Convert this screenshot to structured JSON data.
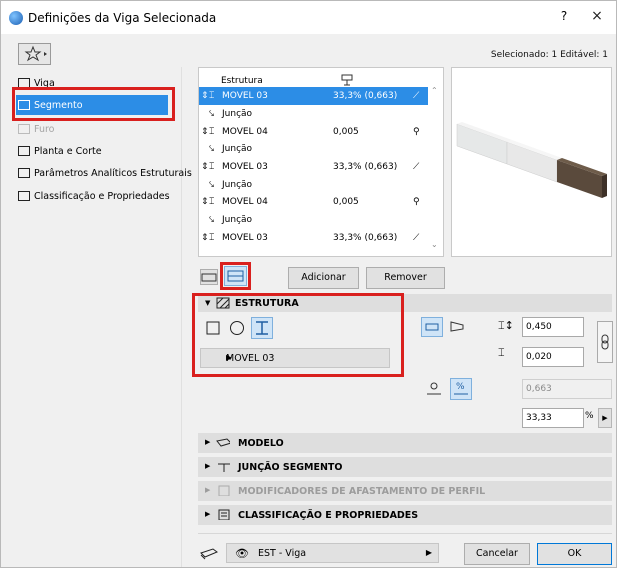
{
  "window": {
    "title": "Definições da Viga Selecionada",
    "help": "?",
    "close": "×"
  },
  "header": {
    "selected_info": "Selecionado: 1 Editável: 1"
  },
  "nav": {
    "items": [
      {
        "label": "Viga"
      },
      {
        "label": "Segmento"
      },
      {
        "label": "Furo"
      },
      {
        "label": "Planta e Corte"
      },
      {
        "label": "Parâmetros Analíticos Estruturais"
      },
      {
        "label": "Classificação e Propriedades"
      }
    ]
  },
  "segment_list": {
    "column_header": "Estrutura",
    "rows": [
      {
        "profile": "MOVEL 03",
        "value": "33,3% (0,663)"
      },
      {
        "junction": "Junção"
      },
      {
        "profile": "MOVEL 04",
        "value": "0,005"
      },
      {
        "junction": "Junção"
      },
      {
        "profile": "MOVEL 03",
        "value": "33,3% (0,663)"
      },
      {
        "junction": "Junção"
      },
      {
        "profile": "MOVEL 04",
        "value": "0,005"
      },
      {
        "junction": "Junção"
      },
      {
        "profile": "MOVEL 03",
        "value": "33,3% (0,663)"
      }
    ]
  },
  "buttons": {
    "add": "Adicionar",
    "remove": "Remover",
    "cancel": "Cancelar",
    "ok": "OK"
  },
  "estrutura": {
    "title": "ESTRUTURA",
    "profile": "MOVEL 03",
    "height": "0,450",
    "width": "0,020",
    "slope_value": "0,663",
    "percent_value": "33,33",
    "percent_unit": "%"
  },
  "sections": {
    "modelo": "MODELO",
    "juncao": "JUNÇÃO SEGMENTO",
    "modificadores": "MODIFICADORES DE AFASTAMENTO DE PERFIL",
    "classificacao": "CLASSIFICAÇÃO E PROPRIEDADES"
  },
  "footer": {
    "layer": "EST - Viga"
  },
  "colors": {
    "selection": "#2c8de6",
    "highlight": "#d9201e"
  }
}
